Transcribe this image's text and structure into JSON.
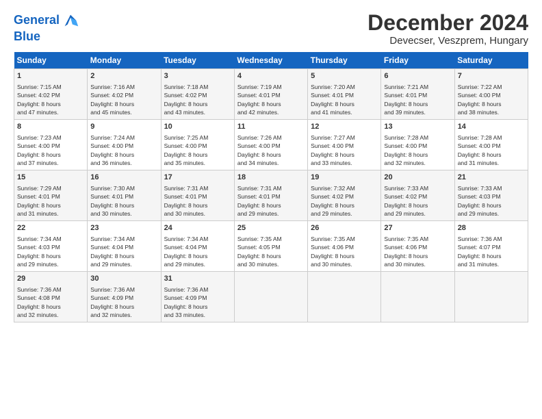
{
  "logo": {
    "line1": "General",
    "line2": "Blue"
  },
  "title": "December 2024",
  "subtitle": "Devecser, Veszprem, Hungary",
  "headers": [
    "Sunday",
    "Monday",
    "Tuesday",
    "Wednesday",
    "Thursday",
    "Friday",
    "Saturday"
  ],
  "weeks": [
    [
      {
        "day": "1",
        "info": "Sunrise: 7:15 AM\nSunset: 4:02 PM\nDaylight: 8 hours\nand 47 minutes."
      },
      {
        "day": "2",
        "info": "Sunrise: 7:16 AM\nSunset: 4:02 PM\nDaylight: 8 hours\nand 45 minutes."
      },
      {
        "day": "3",
        "info": "Sunrise: 7:18 AM\nSunset: 4:02 PM\nDaylight: 8 hours\nand 43 minutes."
      },
      {
        "day": "4",
        "info": "Sunrise: 7:19 AM\nSunset: 4:01 PM\nDaylight: 8 hours\nand 42 minutes."
      },
      {
        "day": "5",
        "info": "Sunrise: 7:20 AM\nSunset: 4:01 PM\nDaylight: 8 hours\nand 41 minutes."
      },
      {
        "day": "6",
        "info": "Sunrise: 7:21 AM\nSunset: 4:01 PM\nDaylight: 8 hours\nand 39 minutes."
      },
      {
        "day": "7",
        "info": "Sunrise: 7:22 AM\nSunset: 4:00 PM\nDaylight: 8 hours\nand 38 minutes."
      }
    ],
    [
      {
        "day": "8",
        "info": "Sunrise: 7:23 AM\nSunset: 4:00 PM\nDaylight: 8 hours\nand 37 minutes."
      },
      {
        "day": "9",
        "info": "Sunrise: 7:24 AM\nSunset: 4:00 PM\nDaylight: 8 hours\nand 36 minutes."
      },
      {
        "day": "10",
        "info": "Sunrise: 7:25 AM\nSunset: 4:00 PM\nDaylight: 8 hours\nand 35 minutes."
      },
      {
        "day": "11",
        "info": "Sunrise: 7:26 AM\nSunset: 4:00 PM\nDaylight: 8 hours\nand 34 minutes."
      },
      {
        "day": "12",
        "info": "Sunrise: 7:27 AM\nSunset: 4:00 PM\nDaylight: 8 hours\nand 33 minutes."
      },
      {
        "day": "13",
        "info": "Sunrise: 7:28 AM\nSunset: 4:00 PM\nDaylight: 8 hours\nand 32 minutes."
      },
      {
        "day": "14",
        "info": "Sunrise: 7:28 AM\nSunset: 4:00 PM\nDaylight: 8 hours\nand 31 minutes."
      }
    ],
    [
      {
        "day": "15",
        "info": "Sunrise: 7:29 AM\nSunset: 4:01 PM\nDaylight: 8 hours\nand 31 minutes."
      },
      {
        "day": "16",
        "info": "Sunrise: 7:30 AM\nSunset: 4:01 PM\nDaylight: 8 hours\nand 30 minutes."
      },
      {
        "day": "17",
        "info": "Sunrise: 7:31 AM\nSunset: 4:01 PM\nDaylight: 8 hours\nand 30 minutes."
      },
      {
        "day": "18",
        "info": "Sunrise: 7:31 AM\nSunset: 4:01 PM\nDaylight: 8 hours\nand 29 minutes."
      },
      {
        "day": "19",
        "info": "Sunrise: 7:32 AM\nSunset: 4:02 PM\nDaylight: 8 hours\nand 29 minutes."
      },
      {
        "day": "20",
        "info": "Sunrise: 7:33 AM\nSunset: 4:02 PM\nDaylight: 8 hours\nand 29 minutes."
      },
      {
        "day": "21",
        "info": "Sunrise: 7:33 AM\nSunset: 4:03 PM\nDaylight: 8 hours\nand 29 minutes."
      }
    ],
    [
      {
        "day": "22",
        "info": "Sunrise: 7:34 AM\nSunset: 4:03 PM\nDaylight: 8 hours\nand 29 minutes."
      },
      {
        "day": "23",
        "info": "Sunrise: 7:34 AM\nSunset: 4:04 PM\nDaylight: 8 hours\nand 29 minutes."
      },
      {
        "day": "24",
        "info": "Sunrise: 7:34 AM\nSunset: 4:04 PM\nDaylight: 8 hours\nand 29 minutes."
      },
      {
        "day": "25",
        "info": "Sunrise: 7:35 AM\nSunset: 4:05 PM\nDaylight: 8 hours\nand 30 minutes."
      },
      {
        "day": "26",
        "info": "Sunrise: 7:35 AM\nSunset: 4:06 PM\nDaylight: 8 hours\nand 30 minutes."
      },
      {
        "day": "27",
        "info": "Sunrise: 7:35 AM\nSunset: 4:06 PM\nDaylight: 8 hours\nand 30 minutes."
      },
      {
        "day": "28",
        "info": "Sunrise: 7:36 AM\nSunset: 4:07 PM\nDaylight: 8 hours\nand 31 minutes."
      }
    ],
    [
      {
        "day": "29",
        "info": "Sunrise: 7:36 AM\nSunset: 4:08 PM\nDaylight: 8 hours\nand 32 minutes."
      },
      {
        "day": "30",
        "info": "Sunrise: 7:36 AM\nSunset: 4:09 PM\nDaylight: 8 hours\nand 32 minutes."
      },
      {
        "day": "31",
        "info": "Sunrise: 7:36 AM\nSunset: 4:09 PM\nDaylight: 8 hours\nand 33 minutes."
      },
      {
        "day": "",
        "info": ""
      },
      {
        "day": "",
        "info": ""
      },
      {
        "day": "",
        "info": ""
      },
      {
        "day": "",
        "info": ""
      }
    ]
  ]
}
